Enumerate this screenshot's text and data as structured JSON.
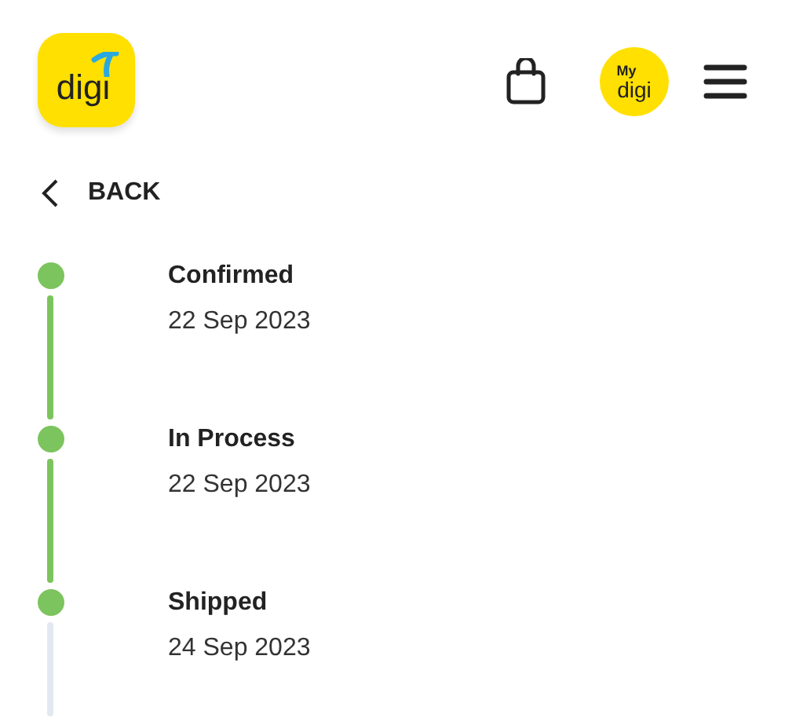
{
  "header": {
    "logo": "digi",
    "mydigi_logo": [
      "My",
      "digi"
    ]
  },
  "back": {
    "label": "BACK"
  },
  "steps": [
    {
      "title": "Confirmed",
      "date": "22 Sep 2023",
      "done": true
    },
    {
      "title": "In Process",
      "date": "22 Sep 2023",
      "done": true
    },
    {
      "title": "Shipped",
      "date": "24 Sep 2023",
      "done": true
    }
  ]
}
